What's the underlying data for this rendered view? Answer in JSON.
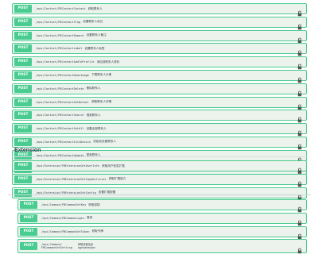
{
  "method_label": "POST",
  "group_a": [
    {
      "path": "/api/Contact/FBContactContact",
      "summary": "获取联系人"
    },
    {
      "path": "/api/Contact/FBContactFlag",
      "summary": "设置联系人标记"
    },
    {
      "path": "/api/Contact/FBContactRemark",
      "summary": "设置联系人备注"
    },
    {
      "path": "/api/Contact/FBContactLabel",
      "summary": "设置联系人标签"
    },
    {
      "path": "/api/Contact/FBContactAddToProfile",
      "summary": "添加到联系人资料"
    },
    {
      "path": "/api/Contact/FBContactDownImage",
      "summary": "下载联系人头像"
    },
    {
      "path": "/api/Contact/FBContactDelete",
      "summary": "删除联系人"
    },
    {
      "path": "/api/Contact/FBContactGetDetail",
      "summary": "获取联系人详情"
    },
    {
      "path": "/api/Contact/FBContactSearch",
      "summary": "搜索联系人"
    },
    {
      "path": "/api/Contact/FBContactSetAll",
      "summary": "设置全部联系人"
    },
    {
      "path": "/api/Contact/FBContactInitDevice",
      "summary": "初始化设备联系人"
    },
    {
      "path": "/api/Contact/FBContactUpdate",
      "summary": "更新联系人"
    },
    {
      "path": "/api/Contact/FBContactUpload",
      "summary": "上传联系人"
    }
  ],
  "section_title": "Extension",
  "group_b": [
    {
      "path": "/api/Extension/FBExtensionGetUserInfo",
      "summary": "获取用户信息扩展"
    },
    {
      "path": "/api/Extension/FBExtensionGetCapabilities",
      "summary": "获取扩展能力"
    },
    {
      "path": "/api/Extension/FBExtensionSetConfig",
      "summary": "设置扩展配置"
    }
  ],
  "group_c": [
    {
      "path": "/api/Common/FBCommonGetKey",
      "summary": "获取密钥"
    },
    {
      "path": "/api/Common/FBCommonLogin",
      "summary": "登录"
    },
    {
      "path": "/api/Common/FBCommonGetToken",
      "summary": "获取令牌"
    }
  ],
  "group_c_last": {
    "path_line1": "/api/Common/",
    "path_line2": "FBCommonGetSetting",
    "summary_line1": "获取设置信息",
    "summary_line2": "application/json"
  }
}
